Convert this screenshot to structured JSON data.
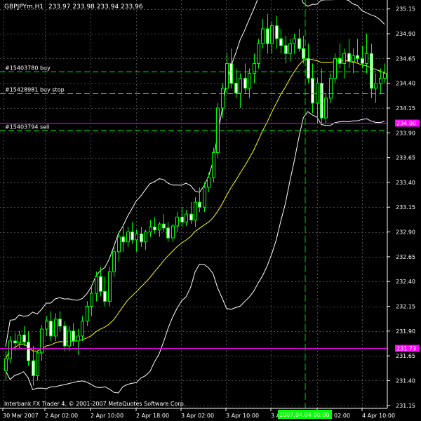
{
  "window": {
    "symbol_label": "GBPJPYm,H1",
    "ohlc_text": "233.97 233.98 233.94 233.96",
    "footer_text": "Interbank FX Trader 4, © 2001-2007 MetaQuotes Software Corp."
  },
  "orders": [
    {
      "label": "#15403780 buy",
      "price": 234.52
    },
    {
      "label": "#15428981 buy stop",
      "price": 234.3
    },
    {
      "label": "#15403794 sell",
      "price": 233.92
    }
  ],
  "price_markers": [
    {
      "text": "234.00",
      "price": 234.0,
      "bg": "#ff00ff"
    },
    {
      "text": "231.73",
      "price": 231.73,
      "bg": "#ff00ff"
    }
  ],
  "crosshair_time_label": "2007.04.04 00:00",
  "colors": {
    "background": "#000000",
    "grid": "#4a4a4a",
    "bull_body": "#000000",
    "bear_body": "#ffffff",
    "candle": "#00ff00",
    "order_line": "#00ff00",
    "marker_line": "#ff00ff",
    "band": "#ffffff",
    "ma": "#ffff00"
  },
  "chart_data": {
    "type": "candlestick",
    "symbol": "GBPJPYm",
    "timeframe": "H1",
    "ylim": [
      231.12,
      235.24
    ],
    "y_ticks": [
      "235.15",
      "234.90",
      "234.65",
      "234.40",
      "234.15",
      "233.90",
      "233.65",
      "233.40",
      "233.15",
      "232.90",
      "232.65",
      "232.40",
      "232.15",
      "231.90",
      "231.65",
      "231.40",
      "231.15"
    ],
    "x_ticks": [
      "30 Mar 2007",
      "2 Apr 02:00",
      "2 Apr 10:00",
      "2 Apr 18:00",
      "3 Apr 02:00",
      "3 Apr 10:00",
      "3 Apr 18:00",
      "4 Apr 02:00",
      "4 Apr 10:00"
    ],
    "candles": [
      [
        231.5,
        231.7,
        231.4,
        231.62
      ],
      [
        231.62,
        231.85,
        231.58,
        231.8
      ],
      [
        231.8,
        231.88,
        231.7,
        231.78
      ],
      [
        231.78,
        231.9,
        231.72,
        231.86
      ],
      [
        231.86,
        231.95,
        231.75,
        231.79
      ],
      [
        231.79,
        231.9,
        231.55,
        231.6
      ],
      [
        231.6,
        231.75,
        231.35,
        231.45
      ],
      [
        231.45,
        231.7,
        231.4,
        231.68
      ],
      [
        231.68,
        231.96,
        231.6,
        231.92
      ],
      [
        231.92,
        232.05,
        231.85,
        232.0
      ],
      [
        232.0,
        232.1,
        231.8,
        231.85
      ],
      [
        231.85,
        232.08,
        231.8,
        232.02
      ],
      [
        232.02,
        232.1,
        231.9,
        231.95
      ],
      [
        231.95,
        232.0,
        231.7,
        231.75
      ],
      [
        231.75,
        231.95,
        231.7,
        231.9
      ],
      [
        231.9,
        231.98,
        231.75,
        231.8
      ],
      [
        231.8,
        231.92,
        231.66,
        231.85
      ],
      [
        231.85,
        232.05,
        231.8,
        232.0
      ],
      [
        232.0,
        232.2,
        231.95,
        232.15
      ],
      [
        232.15,
        232.35,
        232.05,
        232.28
      ],
      [
        232.28,
        232.5,
        232.2,
        232.45
      ],
      [
        232.45,
        232.55,
        232.25,
        232.3
      ],
      [
        232.3,
        232.45,
        232.15,
        232.2
      ],
      [
        232.2,
        232.55,
        232.15,
        232.5
      ],
      [
        232.5,
        232.75,
        232.45,
        232.7
      ],
      [
        232.7,
        232.9,
        232.6,
        232.85
      ],
      [
        232.85,
        232.98,
        232.7,
        232.8
      ],
      [
        232.8,
        232.95,
        232.75,
        232.9
      ],
      [
        232.9,
        233.0,
        232.78,
        232.82
      ],
      [
        232.82,
        232.92,
        232.7,
        232.88
      ],
      [
        232.88,
        232.95,
        232.75,
        232.8
      ],
      [
        232.8,
        232.92,
        232.72,
        232.9
      ],
      [
        232.9,
        233.02,
        232.85,
        232.95
      ],
      [
        232.95,
        233.05,
        232.88,
        232.92
      ],
      [
        232.92,
        233.0,
        232.85,
        232.98
      ],
      [
        232.98,
        233.08,
        232.9,
        232.94
      ],
      [
        232.94,
        233.0,
        232.8,
        232.84
      ],
      [
        232.84,
        232.98,
        232.8,
        232.96
      ],
      [
        232.96,
        233.1,
        232.9,
        233.05
      ],
      [
        233.05,
        233.15,
        232.95,
        233.0
      ],
      [
        233.0,
        233.12,
        232.96,
        233.08
      ],
      [
        233.08,
        233.2,
        232.98,
        233.02
      ],
      [
        233.02,
        233.25,
        232.95,
        233.2
      ],
      [
        233.2,
        233.35,
        233.1,
        233.15
      ],
      [
        233.15,
        233.4,
        233.1,
        233.35
      ],
      [
        233.35,
        233.5,
        233.3,
        233.45
      ],
      [
        233.45,
        233.75,
        233.4,
        233.7
      ],
      [
        233.7,
        234.2,
        233.65,
        234.15
      ],
      [
        234.15,
        234.4,
        234.05,
        234.35
      ],
      [
        234.35,
        234.7,
        234.3,
        234.6
      ],
      [
        234.6,
        234.75,
        234.35,
        234.4
      ],
      [
        234.4,
        234.55,
        234.25,
        234.3
      ],
      [
        234.3,
        234.5,
        234.15,
        234.45
      ],
      [
        234.45,
        234.6,
        234.3,
        234.35
      ],
      [
        234.35,
        234.55,
        234.25,
        234.5
      ],
      [
        234.5,
        234.7,
        234.4,
        234.6
      ],
      [
        234.6,
        234.85,
        234.55,
        234.8
      ],
      [
        234.8,
        235.05,
        234.75,
        234.95
      ],
      [
        234.95,
        235.1,
        234.7,
        234.8
      ],
      [
        234.8,
        235.02,
        234.7,
        234.98
      ],
      [
        234.98,
        235.08,
        234.75,
        234.85
      ],
      [
        234.85,
        234.95,
        234.7,
        234.78
      ],
      [
        234.78,
        234.88,
        234.6,
        234.7
      ],
      [
        234.7,
        234.85,
        234.62,
        234.8
      ],
      [
        234.8,
        234.9,
        234.7,
        234.85
      ],
      [
        234.85,
        234.95,
        234.72,
        234.75
      ],
      [
        234.75,
        234.88,
        234.6,
        234.65
      ],
      [
        234.65,
        234.8,
        234.4,
        234.45
      ],
      [
        234.45,
        234.6,
        234.1,
        234.2
      ],
      [
        234.2,
        234.45,
        234.0,
        234.4
      ],
      [
        234.4,
        234.55,
        234.0,
        234.05
      ],
      [
        234.05,
        234.3,
        234.0,
        234.25
      ],
      [
        234.25,
        234.5,
        234.2,
        234.45
      ],
      [
        234.45,
        234.7,
        234.4,
        234.65
      ],
      [
        234.65,
        234.8,
        234.55,
        234.6
      ],
      [
        234.6,
        234.75,
        234.45,
        234.7
      ],
      [
        234.7,
        234.85,
        234.55,
        234.62
      ],
      [
        234.62,
        234.75,
        234.5,
        234.68
      ],
      [
        234.68,
        234.85,
        234.6,
        234.65
      ],
      [
        234.65,
        234.78,
        234.55,
        234.6
      ],
      [
        234.6,
        234.9,
        234.5,
        234.7
      ],
      [
        234.7,
        234.8,
        234.25,
        234.35
      ],
      [
        234.35,
        234.5,
        234.2,
        234.4
      ],
      [
        234.4,
        234.55,
        234.3,
        234.45
      ],
      [
        234.45,
        234.6,
        234.4,
        234.5
      ]
    ]
  }
}
